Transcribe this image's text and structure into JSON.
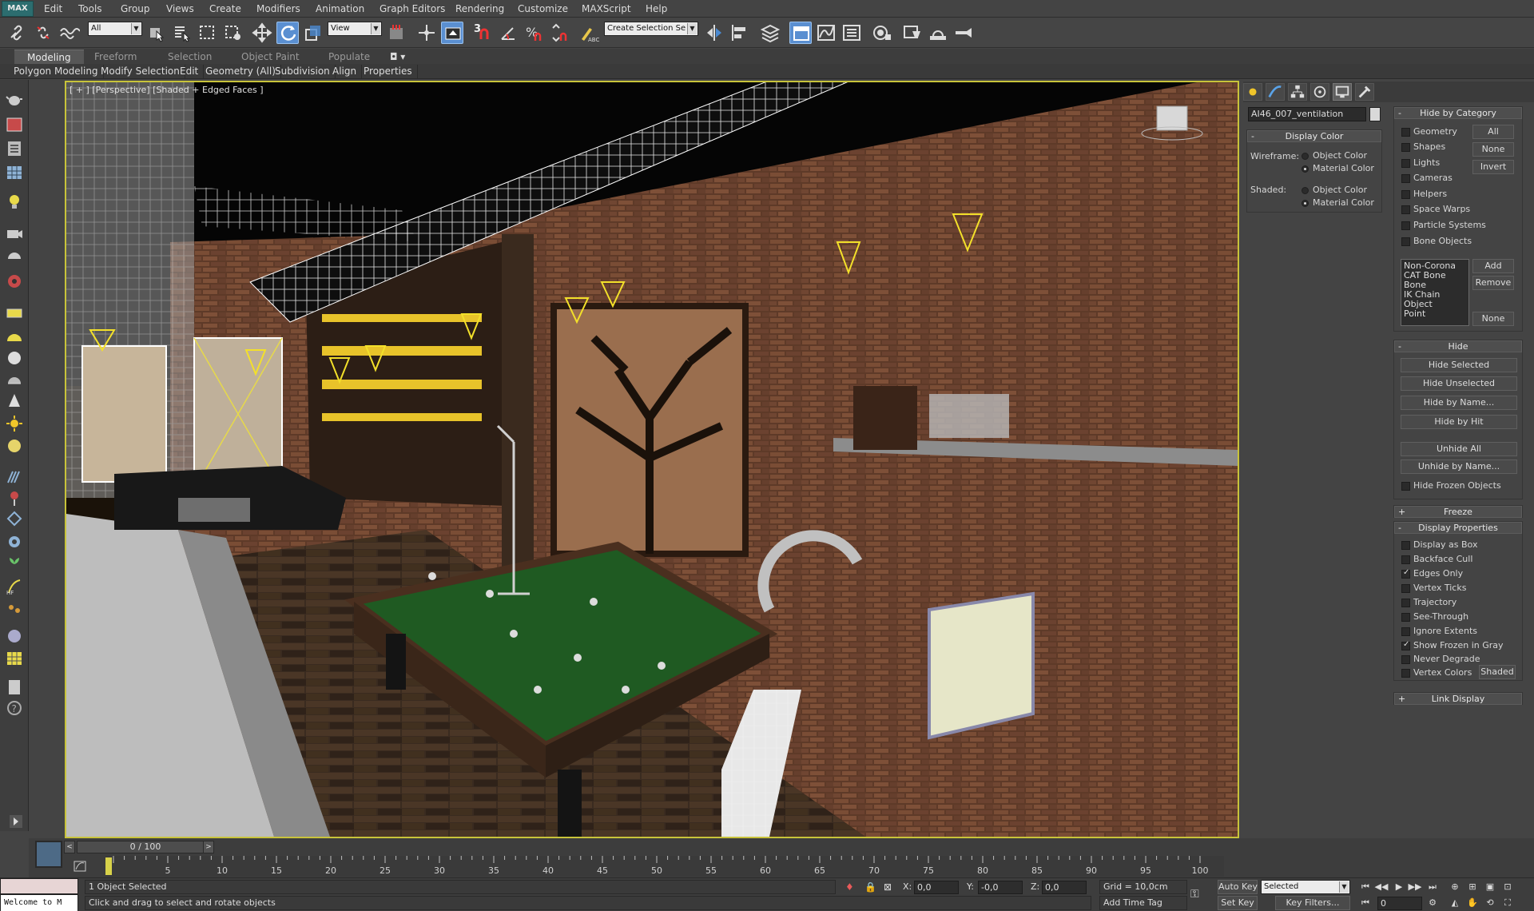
{
  "menubar": {
    "logo": "MAX",
    "items": [
      "Edit",
      "Tools",
      "Group",
      "Views",
      "Create",
      "Modifiers",
      "Animation",
      "Graph Editors",
      "Rendering",
      "Customize",
      "MAXScript",
      "Help"
    ]
  },
  "toolbar": {
    "selection_filter": "All",
    "reference_coordinate": "View",
    "named_selection_placeholder": "Create Selection Se",
    "snap_label": "3"
  },
  "ribbon": {
    "tabs": [
      "Modeling",
      "Freeform",
      "Selection",
      "Object Paint",
      "Populate"
    ],
    "panels": [
      "Polygon Modeling",
      "Modify Selection",
      "Edit",
      "Geometry (All)",
      "Subdivision",
      "Align",
      "Properties"
    ]
  },
  "viewport": {
    "label": "[ + ] [Perspective] [Shaded + Edged Faces ]"
  },
  "command_panel": {
    "object_name": "AI46_007_ventilation",
    "display_color": {
      "title": "Display Color",
      "wireframe_label": "Wireframe:",
      "shaded_label": "Shaded:",
      "object_color": "Object Color",
      "material_color": "Material Color"
    },
    "hide_by_category": {
      "title": "Hide by Category",
      "items": [
        "Geometry",
        "Shapes",
        "Lights",
        "Cameras",
        "Helpers",
        "Space Warps",
        "Particle Systems",
        "Bone Objects"
      ],
      "btn_all": "All",
      "btn_none": "None",
      "btn_invert": "Invert",
      "list": [
        "Non-Corona",
        "CAT Bone",
        "Bone",
        "IK Chain Object",
        "Point"
      ],
      "btn_add": "Add",
      "btn_remove": "Remove",
      "btn_none2": "None"
    },
    "hide": {
      "title": "Hide",
      "buttons": [
        "Hide Selected",
        "Hide Unselected",
        "Hide by Name...",
        "Hide by Hit",
        "Unhide All",
        "Unhide by Name..."
      ],
      "hide_frozen": "Hide Frozen Objects"
    },
    "freeze_title": "Freeze",
    "display_properties": {
      "title": "Display Properties",
      "items": [
        {
          "label": "Display as Box",
          "checked": false
        },
        {
          "label": "Backface Cull",
          "checked": false
        },
        {
          "label": "Edges Only",
          "checked": true
        },
        {
          "label": "Vertex Ticks",
          "checked": false
        },
        {
          "label": "Trajectory",
          "checked": false
        },
        {
          "label": "See-Through",
          "checked": false
        },
        {
          "label": "Ignore Extents",
          "checked": false
        },
        {
          "label": "Show Frozen in Gray",
          "checked": true
        },
        {
          "label": "Never Degrade",
          "checked": false
        },
        {
          "label": "Vertex Colors",
          "checked": false
        }
      ],
      "shaded_button": "Shaded"
    },
    "link_display_title": "Link Display"
  },
  "timeline": {
    "slider_text": "0 / 100",
    "ticks": [
      0,
      5,
      10,
      15,
      20,
      25,
      30,
      35,
      40,
      45,
      50,
      55,
      60,
      65,
      70,
      75,
      80,
      85,
      90,
      95,
      100
    ]
  },
  "status": {
    "welcome_line1": "",
    "welcome_line2": "Welcome to M",
    "selected_text": "1 Object Selected",
    "prompt_text": "Click and drag to select and rotate objects",
    "x_label": "X:",
    "x_value": "0,0",
    "y_label": "Y:",
    "y_value": "-0,0",
    "z_label": "Z:",
    "z_value": "0,0",
    "grid_text": "Grid = 10,0cm",
    "add_time_tag": "Add Time Tag",
    "auto_key": "Auto Key",
    "set_key": "Set Key",
    "selected_dropdown": "Selected",
    "key_filters": "Key Filters...",
    "frame_value": "0"
  }
}
